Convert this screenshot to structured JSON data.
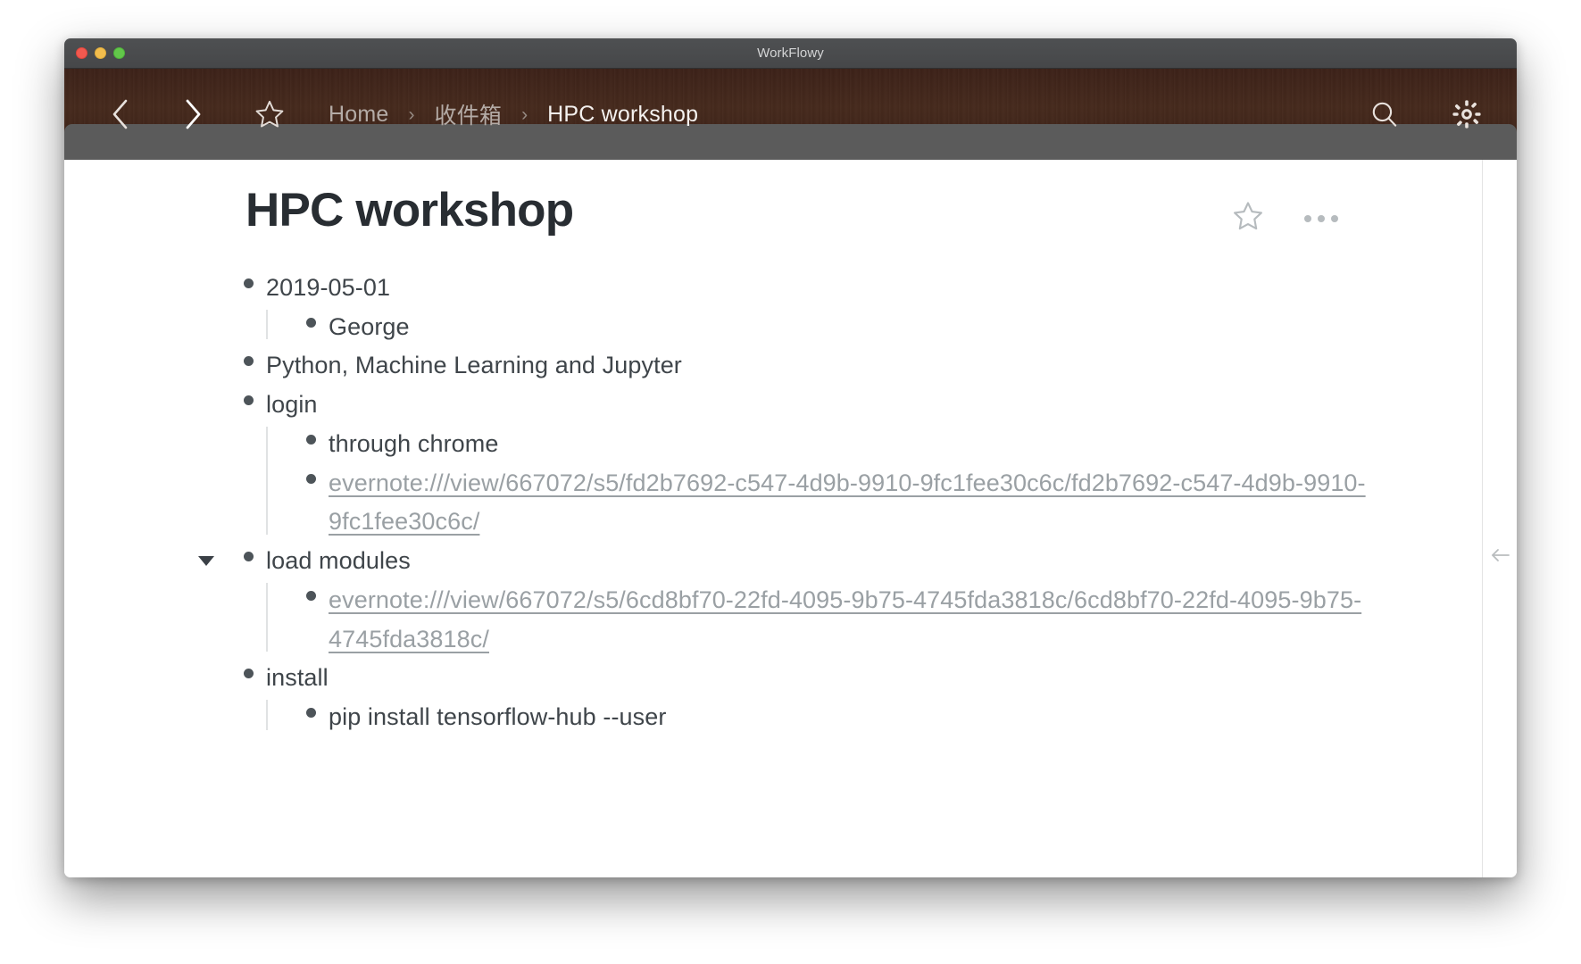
{
  "window": {
    "title": "WorkFlowy",
    "traffic_lights": [
      "close-red",
      "minimize-yellow",
      "maximize-green"
    ]
  },
  "nav": {
    "back_icon": "chevron-left-icon",
    "forward_icon": "chevron-right-icon",
    "star_icon": "star-outline-icon",
    "search_icon": "search-icon",
    "settings_icon": "gear-icon",
    "breadcrumb": [
      {
        "label": "Home",
        "current": false
      },
      {
        "label": "收件箱",
        "current": false
      },
      {
        "label": "HPC workshop",
        "current": true
      }
    ],
    "separator": "›"
  },
  "page": {
    "title": "HPC workshop",
    "star_icon": "star-outline-icon",
    "menu_icon": "ellipsis-icon",
    "collapse_sidebar_icon": "arrow-left-icon"
  },
  "outline": [
    {
      "text": "2019-05-01",
      "type": "text",
      "children": [
        {
          "text": "George",
          "type": "text"
        }
      ]
    },
    {
      "text": "Python, Machine Learning and Jupyter",
      "type": "text",
      "children": []
    },
    {
      "text": "login",
      "type": "text",
      "children": [
        {
          "text": "through chrome",
          "type": "text"
        },
        {
          "text": "evernote:///view/667072/s5/fd2b7692-c547-4d9b-9910-9fc1fee30c6c/fd2b7692-c547-4d9b-9910-9fc1fee30c6c/",
          "type": "link"
        }
      ]
    },
    {
      "text": "load modules",
      "type": "text",
      "expanded": true,
      "children": [
        {
          "text": "evernote:///view/667072/s5/6cd8bf70-22fd-4095-9b75-4745fda3818c/6cd8bf70-22fd-4095-9b75-4745fda3818c/",
          "type": "link"
        }
      ]
    },
    {
      "text": "install",
      "type": "text",
      "children": [
        {
          "text": "pip install tensorflow-hub --user",
          "type": "text"
        }
      ]
    }
  ],
  "colors": {
    "wood": "#42271b",
    "toolbar_gray": "#5b5b5b",
    "titlebar": "#4a4c4e",
    "title_text": "#282d32",
    "body_text": "#3f454a",
    "link_text": "#9aa0a4",
    "guide_line": "#e0e2e3"
  }
}
